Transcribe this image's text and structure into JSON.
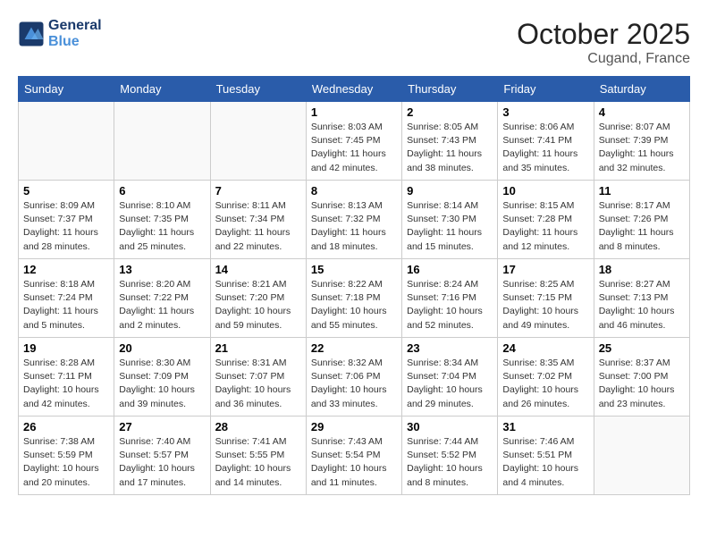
{
  "header": {
    "logo_line1": "General",
    "logo_line2": "Blue",
    "month": "October 2025",
    "location": "Cugand, France"
  },
  "weekdays": [
    "Sunday",
    "Monday",
    "Tuesday",
    "Wednesday",
    "Thursday",
    "Friday",
    "Saturday"
  ],
  "weeks": [
    [
      {
        "day": "",
        "sunrise": "",
        "sunset": "",
        "daylight": ""
      },
      {
        "day": "",
        "sunrise": "",
        "sunset": "",
        "daylight": ""
      },
      {
        "day": "",
        "sunrise": "",
        "sunset": "",
        "daylight": ""
      },
      {
        "day": "1",
        "sunrise": "Sunrise: 8:03 AM",
        "sunset": "Sunset: 7:45 PM",
        "daylight": "Daylight: 11 hours and 42 minutes."
      },
      {
        "day": "2",
        "sunrise": "Sunrise: 8:05 AM",
        "sunset": "Sunset: 7:43 PM",
        "daylight": "Daylight: 11 hours and 38 minutes."
      },
      {
        "day": "3",
        "sunrise": "Sunrise: 8:06 AM",
        "sunset": "Sunset: 7:41 PM",
        "daylight": "Daylight: 11 hours and 35 minutes."
      },
      {
        "day": "4",
        "sunrise": "Sunrise: 8:07 AM",
        "sunset": "Sunset: 7:39 PM",
        "daylight": "Daylight: 11 hours and 32 minutes."
      }
    ],
    [
      {
        "day": "5",
        "sunrise": "Sunrise: 8:09 AM",
        "sunset": "Sunset: 7:37 PM",
        "daylight": "Daylight: 11 hours and 28 minutes."
      },
      {
        "day": "6",
        "sunrise": "Sunrise: 8:10 AM",
        "sunset": "Sunset: 7:35 PM",
        "daylight": "Daylight: 11 hours and 25 minutes."
      },
      {
        "day": "7",
        "sunrise": "Sunrise: 8:11 AM",
        "sunset": "Sunset: 7:34 PM",
        "daylight": "Daylight: 11 hours and 22 minutes."
      },
      {
        "day": "8",
        "sunrise": "Sunrise: 8:13 AM",
        "sunset": "Sunset: 7:32 PM",
        "daylight": "Daylight: 11 hours and 18 minutes."
      },
      {
        "day": "9",
        "sunrise": "Sunrise: 8:14 AM",
        "sunset": "Sunset: 7:30 PM",
        "daylight": "Daylight: 11 hours and 15 minutes."
      },
      {
        "day": "10",
        "sunrise": "Sunrise: 8:15 AM",
        "sunset": "Sunset: 7:28 PM",
        "daylight": "Daylight: 11 hours and 12 minutes."
      },
      {
        "day": "11",
        "sunrise": "Sunrise: 8:17 AM",
        "sunset": "Sunset: 7:26 PM",
        "daylight": "Daylight: 11 hours and 8 minutes."
      }
    ],
    [
      {
        "day": "12",
        "sunrise": "Sunrise: 8:18 AM",
        "sunset": "Sunset: 7:24 PM",
        "daylight": "Daylight: 11 hours and 5 minutes."
      },
      {
        "day": "13",
        "sunrise": "Sunrise: 8:20 AM",
        "sunset": "Sunset: 7:22 PM",
        "daylight": "Daylight: 11 hours and 2 minutes."
      },
      {
        "day": "14",
        "sunrise": "Sunrise: 8:21 AM",
        "sunset": "Sunset: 7:20 PM",
        "daylight": "Daylight: 10 hours and 59 minutes."
      },
      {
        "day": "15",
        "sunrise": "Sunrise: 8:22 AM",
        "sunset": "Sunset: 7:18 PM",
        "daylight": "Daylight: 10 hours and 55 minutes."
      },
      {
        "day": "16",
        "sunrise": "Sunrise: 8:24 AM",
        "sunset": "Sunset: 7:16 PM",
        "daylight": "Daylight: 10 hours and 52 minutes."
      },
      {
        "day": "17",
        "sunrise": "Sunrise: 8:25 AM",
        "sunset": "Sunset: 7:15 PM",
        "daylight": "Daylight: 10 hours and 49 minutes."
      },
      {
        "day": "18",
        "sunrise": "Sunrise: 8:27 AM",
        "sunset": "Sunset: 7:13 PM",
        "daylight": "Daylight: 10 hours and 46 minutes."
      }
    ],
    [
      {
        "day": "19",
        "sunrise": "Sunrise: 8:28 AM",
        "sunset": "Sunset: 7:11 PM",
        "daylight": "Daylight: 10 hours and 42 minutes."
      },
      {
        "day": "20",
        "sunrise": "Sunrise: 8:30 AM",
        "sunset": "Sunset: 7:09 PM",
        "daylight": "Daylight: 10 hours and 39 minutes."
      },
      {
        "day": "21",
        "sunrise": "Sunrise: 8:31 AM",
        "sunset": "Sunset: 7:07 PM",
        "daylight": "Daylight: 10 hours and 36 minutes."
      },
      {
        "day": "22",
        "sunrise": "Sunrise: 8:32 AM",
        "sunset": "Sunset: 7:06 PM",
        "daylight": "Daylight: 10 hours and 33 minutes."
      },
      {
        "day": "23",
        "sunrise": "Sunrise: 8:34 AM",
        "sunset": "Sunset: 7:04 PM",
        "daylight": "Daylight: 10 hours and 29 minutes."
      },
      {
        "day": "24",
        "sunrise": "Sunrise: 8:35 AM",
        "sunset": "Sunset: 7:02 PM",
        "daylight": "Daylight: 10 hours and 26 minutes."
      },
      {
        "day": "25",
        "sunrise": "Sunrise: 8:37 AM",
        "sunset": "Sunset: 7:00 PM",
        "daylight": "Daylight: 10 hours and 23 minutes."
      }
    ],
    [
      {
        "day": "26",
        "sunrise": "Sunrise: 7:38 AM",
        "sunset": "Sunset: 5:59 PM",
        "daylight": "Daylight: 10 hours and 20 minutes."
      },
      {
        "day": "27",
        "sunrise": "Sunrise: 7:40 AM",
        "sunset": "Sunset: 5:57 PM",
        "daylight": "Daylight: 10 hours and 17 minutes."
      },
      {
        "day": "28",
        "sunrise": "Sunrise: 7:41 AM",
        "sunset": "Sunset: 5:55 PM",
        "daylight": "Daylight: 10 hours and 14 minutes."
      },
      {
        "day": "29",
        "sunrise": "Sunrise: 7:43 AM",
        "sunset": "Sunset: 5:54 PM",
        "daylight": "Daylight: 10 hours and 11 minutes."
      },
      {
        "day": "30",
        "sunrise": "Sunrise: 7:44 AM",
        "sunset": "Sunset: 5:52 PM",
        "daylight": "Daylight: 10 hours and 8 minutes."
      },
      {
        "day": "31",
        "sunrise": "Sunrise: 7:46 AM",
        "sunset": "Sunset: 5:51 PM",
        "daylight": "Daylight: 10 hours and 4 minutes."
      },
      {
        "day": "",
        "sunrise": "",
        "sunset": "",
        "daylight": ""
      }
    ]
  ]
}
